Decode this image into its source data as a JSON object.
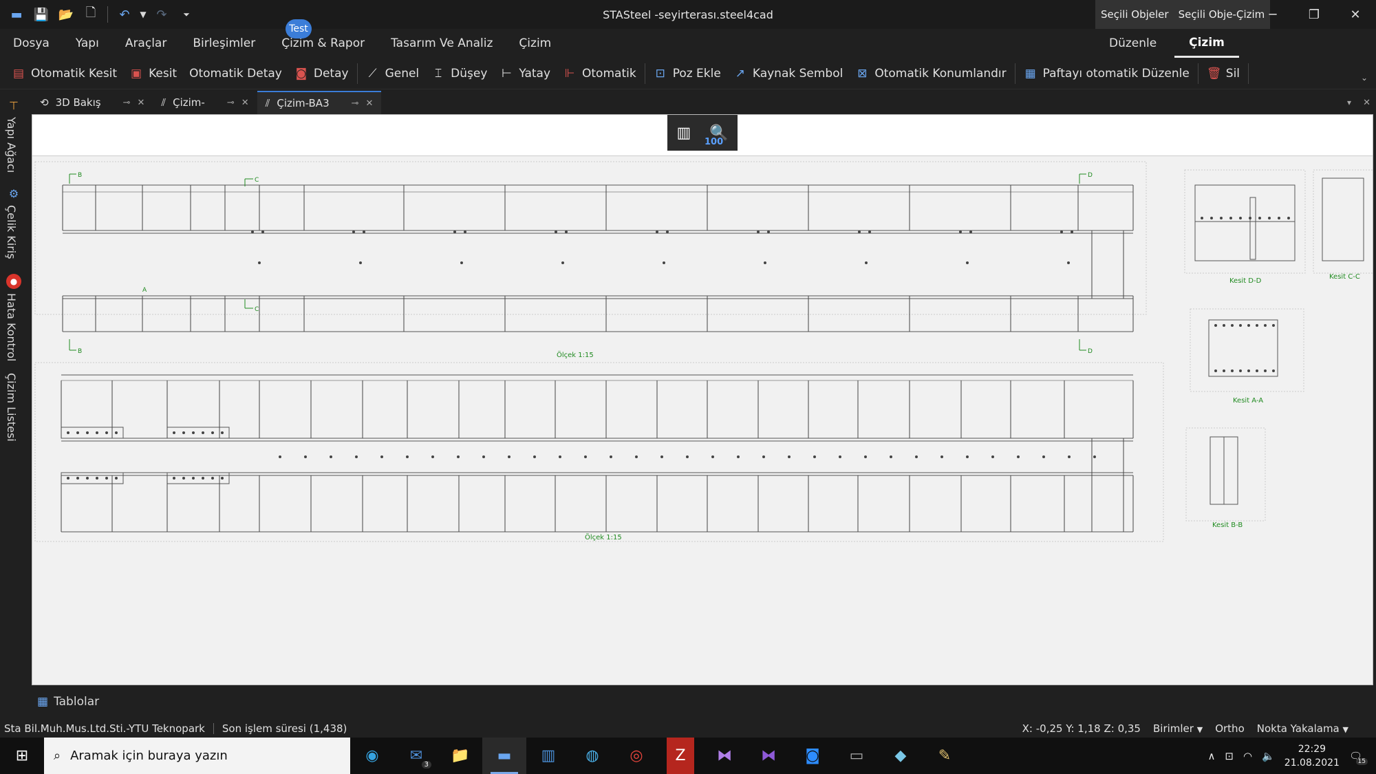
{
  "window": {
    "title": "STASteel -seyirterası.steel4cad",
    "ctx_tabs": [
      "Seçili Objeler",
      "Seçili Obje-Çizim"
    ]
  },
  "quick_access": {
    "icons": [
      "app-icon",
      "save-icon",
      "open-icon",
      "new-icon",
      "undo-icon",
      "undo-dropdown-icon",
      "redo-icon",
      "customize-icon"
    ]
  },
  "menu": {
    "items": [
      "Dosya",
      "Yapı",
      "Araçlar",
      "Birleşimler",
      "Çizim & Rapor",
      "Tasarım Ve Analiz",
      "Çizim"
    ],
    "badge": "Test",
    "right": [
      "Düzenle",
      "Çizim"
    ]
  },
  "toolbar": {
    "items": [
      {
        "label": "Otomatik Kesit",
        "icon": "▤"
      },
      {
        "label": "Kesit",
        "icon": "▣"
      },
      {
        "label": "Otomatik Detay",
        "icon": ""
      },
      {
        "label": "Detay",
        "icon": "◙"
      },
      {
        "label": "Genel",
        "icon": "⟋"
      },
      {
        "label": "Düşey",
        "icon": "⌶"
      },
      {
        "label": "Yatay",
        "icon": "⊢"
      },
      {
        "label": "Otomatik",
        "icon": "⊩"
      },
      {
        "label": "Poz Ekle",
        "icon": "⊡"
      },
      {
        "label": "Kaynak Sembol",
        "icon": "↗"
      },
      {
        "label": "Otomatik Konumlandır",
        "icon": "⊠"
      },
      {
        "label": "Paftayı otomatik Düzenle",
        "icon": "▦"
      },
      {
        "label": "Sil",
        "icon": "🗑"
      }
    ],
    "separators_after": [
      3,
      7,
      10,
      11,
      12
    ]
  },
  "left_panel": {
    "labels": [
      "Yapı Ağacı",
      "Çelik Kiriş",
      "Hata Kontrol",
      "Çizim Listesi"
    ]
  },
  "tabs": [
    {
      "label": "3D Bakış"
    },
    {
      "label": "Çizim-"
    },
    {
      "label": "Çizim-BA3"
    }
  ],
  "zoom": {
    "value": "100"
  },
  "drawing": {
    "scale_label": "Ölçek 1:15",
    "section_markers": [
      "B",
      "C",
      "D"
    ],
    "section_labels": [
      "Kesit D-D",
      "Kesit C-C",
      "Kesit A-A",
      "Kesit B-B"
    ],
    "marker_a": "A"
  },
  "bottom": {
    "tables": "Tablolar"
  },
  "status": {
    "company": "Sta Bil.Muh.Mus.Ltd.Sti.-YTU Teknopark",
    "last_op": "Son işlem süresi (1,438)",
    "coords": "X: -0,25 Y: 1,18 Z: 0,35",
    "units": "Birimler",
    "ortho": "Ortho",
    "snap": "Nokta Yakalama"
  },
  "taskbar": {
    "search_placeholder": "Aramak için buraya yazın",
    "mail_count": "3",
    "time": "22:29",
    "date": "21.08.2021",
    "notif_count": "15"
  }
}
